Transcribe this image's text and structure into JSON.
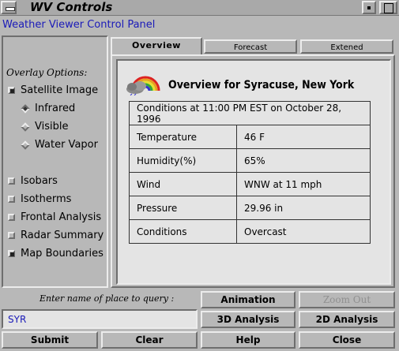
{
  "window": {
    "title": "WV Controls"
  },
  "app_header": "Weather Viewer Control Panel",
  "overlay": {
    "label": "Overlay Options:",
    "satellite_label": "Satellite Image",
    "satellite_checked": true,
    "bands": [
      {
        "label": "Infrared",
        "selected": true
      },
      {
        "label": "Visible",
        "selected": false
      },
      {
        "label": "Water Vapor",
        "selected": false
      }
    ],
    "others": [
      {
        "label": "Isobars",
        "checked": false
      },
      {
        "label": "Isotherms",
        "checked": false
      },
      {
        "label": "Frontal Analysis",
        "checked": false
      },
      {
        "label": "Radar Summary",
        "checked": false
      },
      {
        "label": "Map Boundaries",
        "checked": true
      }
    ]
  },
  "tabs": [
    {
      "label": "Overview",
      "active": true
    },
    {
      "label": "Forecast",
      "active": false
    },
    {
      "label": "Extened",
      "active": false
    }
  ],
  "overview": {
    "title": "Overview for Syracuse, New York",
    "conditions_header": "Conditions at 11:00 PM EST on October 28, 1996",
    "rows": [
      {
        "label": "Temperature",
        "value": "46 F"
      },
      {
        "label": "Humidity(%)",
        "value": "65%"
      },
      {
        "label": "Wind",
        "value": "WNW at 11 mph"
      },
      {
        "label": "Pressure",
        "value": "29.96 in"
      },
      {
        "label": "Conditions",
        "value": "Overcast"
      }
    ]
  },
  "query": {
    "label": "Enter name of place to query :",
    "value": "SYR"
  },
  "buttons": {
    "animation": "Animation",
    "zoom_out": "Zoom Out",
    "analysis_3d": "3D Analysis",
    "analysis_2d": "2D Analysis",
    "submit": "Submit",
    "clear": "Clear",
    "help": "Help",
    "close": "Close"
  }
}
